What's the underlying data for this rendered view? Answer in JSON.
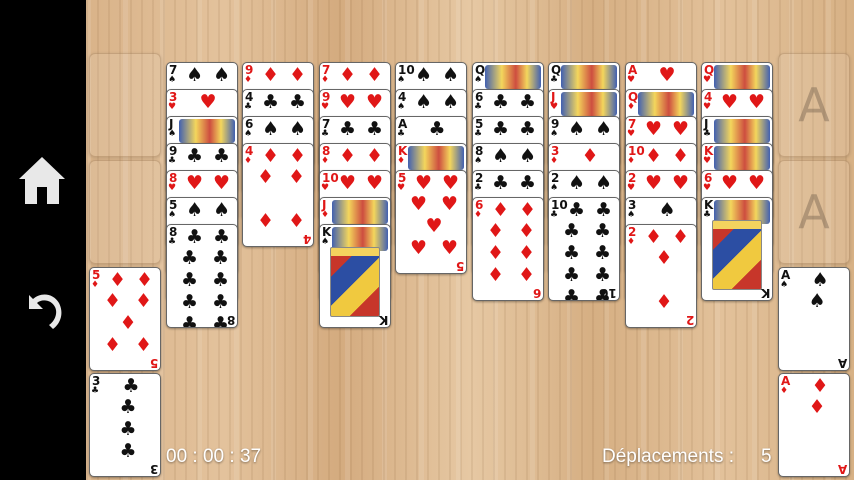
{
  "sidebar": {
    "buttons": [
      {
        "name": "home-button",
        "icon": "home-icon"
      },
      {
        "name": "undo-button",
        "icon": "undo-icon"
      }
    ]
  },
  "status": {
    "timer": "00 : 00 : 37",
    "moves_label": "Déplacements :",
    "moves_value": "5"
  },
  "foundations": [
    {
      "placeholder": "A",
      "card": null
    },
    {
      "placeholder": "A",
      "card": null
    },
    {
      "placeholder": "",
      "card": {
        "rank": "A",
        "suit": "♠"
      }
    },
    {
      "placeholder": "",
      "card": {
        "rank": "A",
        "suit": "♦"
      }
    }
  ],
  "freecells": [
    {
      "card": null
    },
    {
      "card": null
    },
    {
      "card": {
        "rank": "5",
        "suit": "♦"
      }
    },
    {
      "card": {
        "rank": "3",
        "suit": "♣"
      }
    }
  ],
  "tableau": [
    [
      {
        "rank": "7",
        "suit": "♠"
      },
      {
        "rank": "3",
        "suit": "♥"
      },
      {
        "rank": "J",
        "suit": "♠"
      },
      {
        "rank": "9",
        "suit": "♣"
      },
      {
        "rank": "8",
        "suit": "♥"
      },
      {
        "rank": "5",
        "suit": "♠"
      },
      {
        "rank": "8",
        "suit": "♣"
      }
    ],
    [
      {
        "rank": "9",
        "suit": "♦"
      },
      {
        "rank": "4",
        "suit": "♣"
      },
      {
        "rank": "6",
        "suit": "♠"
      },
      {
        "rank": "4",
        "suit": "♦"
      }
    ],
    [
      {
        "rank": "7",
        "suit": "♦"
      },
      {
        "rank": "9",
        "suit": "♥"
      },
      {
        "rank": "7",
        "suit": "♣"
      },
      {
        "rank": "8",
        "suit": "♦"
      },
      {
        "rank": "10",
        "suit": "♥"
      },
      {
        "rank": "J",
        "suit": "♦"
      },
      {
        "rank": "K",
        "suit": "♠"
      }
    ],
    [
      {
        "rank": "10",
        "suit": "♠"
      },
      {
        "rank": "4",
        "suit": "♠"
      },
      {
        "rank": "A",
        "suit": "♣"
      },
      {
        "rank": "K",
        "suit": "♦"
      },
      {
        "rank": "5",
        "suit": "♥"
      }
    ],
    [
      {
        "rank": "Q",
        "suit": "♠"
      },
      {
        "rank": "6",
        "suit": "♣"
      },
      {
        "rank": "5",
        "suit": "♣"
      },
      {
        "rank": "8",
        "suit": "♠"
      },
      {
        "rank": "2",
        "suit": "♣"
      },
      {
        "rank": "6",
        "suit": "♦"
      }
    ],
    [
      {
        "rank": "Q",
        "suit": "♣"
      },
      {
        "rank": "J",
        "suit": "♥"
      },
      {
        "rank": "9",
        "suit": "♠"
      },
      {
        "rank": "3",
        "suit": "♦"
      },
      {
        "rank": "2",
        "suit": "♠"
      },
      {
        "rank": "10",
        "suit": "♣"
      }
    ],
    [
      {
        "rank": "A",
        "suit": "♥"
      },
      {
        "rank": "Q",
        "suit": "♦"
      },
      {
        "rank": "7",
        "suit": "♥"
      },
      {
        "rank": "10",
        "suit": "♦"
      },
      {
        "rank": "2",
        "suit": "♥"
      },
      {
        "rank": "3",
        "suit": "♠"
      },
      {
        "rank": "2",
        "suit": "♦"
      }
    ],
    [
      {
        "rank": "Q",
        "suit": "♥"
      },
      {
        "rank": "4",
        "suit": "♥"
      },
      {
        "rank": "J",
        "suit": "♣"
      },
      {
        "rank": "K",
        "suit": "♥"
      },
      {
        "rank": "6",
        "suit": "♥"
      },
      {
        "rank": "K",
        "suit": "♣"
      }
    ]
  ]
}
